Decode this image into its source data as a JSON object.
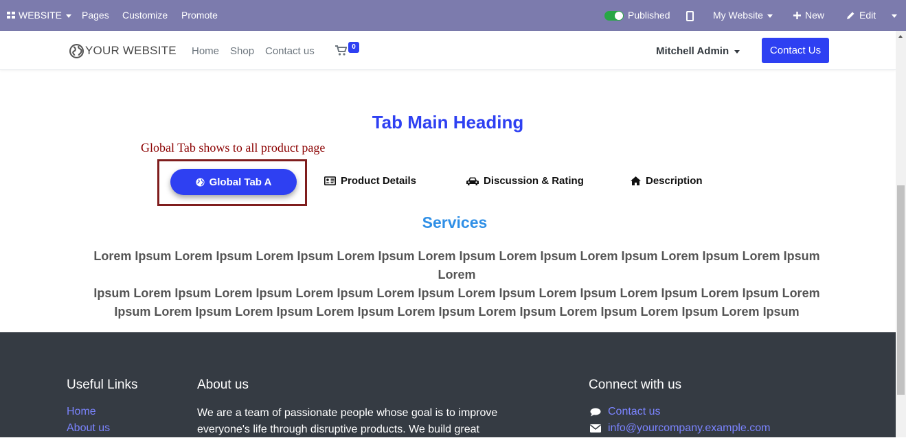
{
  "editbar": {
    "website_label": "WEBSITE",
    "pages_label": "Pages",
    "customize_label": "Customize",
    "promote_label": "Promote",
    "published_label": "Published",
    "my_website_label": "My Website",
    "new_label": "New",
    "edit_label": "Edit"
  },
  "header": {
    "logo_text": "YOUR WEBSITE",
    "nav": [
      "Home",
      "Shop",
      "Contact us"
    ],
    "cart_count": "0",
    "user_name": "Mitchell Admin",
    "contact_button": "Contact Us"
  },
  "content": {
    "main_heading": "Tab Main Heading",
    "annotation": "Global Tab shows to all product page",
    "tabs": [
      "Global Tab A",
      "Product Details",
      "Discussion & Rating",
      "Description"
    ],
    "services_heading": "Services",
    "lorem_lines": [
      "Lorem Ipsum Lorem Ipsum Lorem Ipsum Lorem Ipsum Lorem Ipsum Lorem Ipsum Lorem Ipsum Lorem Ipsum Lorem Ipsum Lorem",
      "Ipsum Lorem Ipsum Lorem Ipsum Lorem Ipsum Lorem Ipsum Lorem Ipsum Lorem Ipsum Lorem Ipsum Lorem Ipsum Lorem",
      "Ipsum Lorem Ipsum Lorem Ipsum Lorem Ipsum Lorem Ipsum Lorem Ipsum Lorem Ipsum Lorem Ipsum Lorem Ipsum"
    ]
  },
  "footer": {
    "useful_links_title": "Useful Links",
    "useful_links": [
      "Home",
      "About us"
    ],
    "about_title": "About us",
    "about_text": "We are a team of passionate people whose goal is to improve everyone's life through disruptive products. We build great",
    "connect_title": "Connect with us",
    "contact_link": "Contact us",
    "email_link": "info@yourcompany.example.com"
  },
  "colors": {
    "editbar_bg": "#7c7bad",
    "primary": "#2e40f2",
    "services": "#2f8fe6",
    "annotation": "#8b0000",
    "footer_bg": "#353b43",
    "footer_link": "#7b84ff"
  }
}
